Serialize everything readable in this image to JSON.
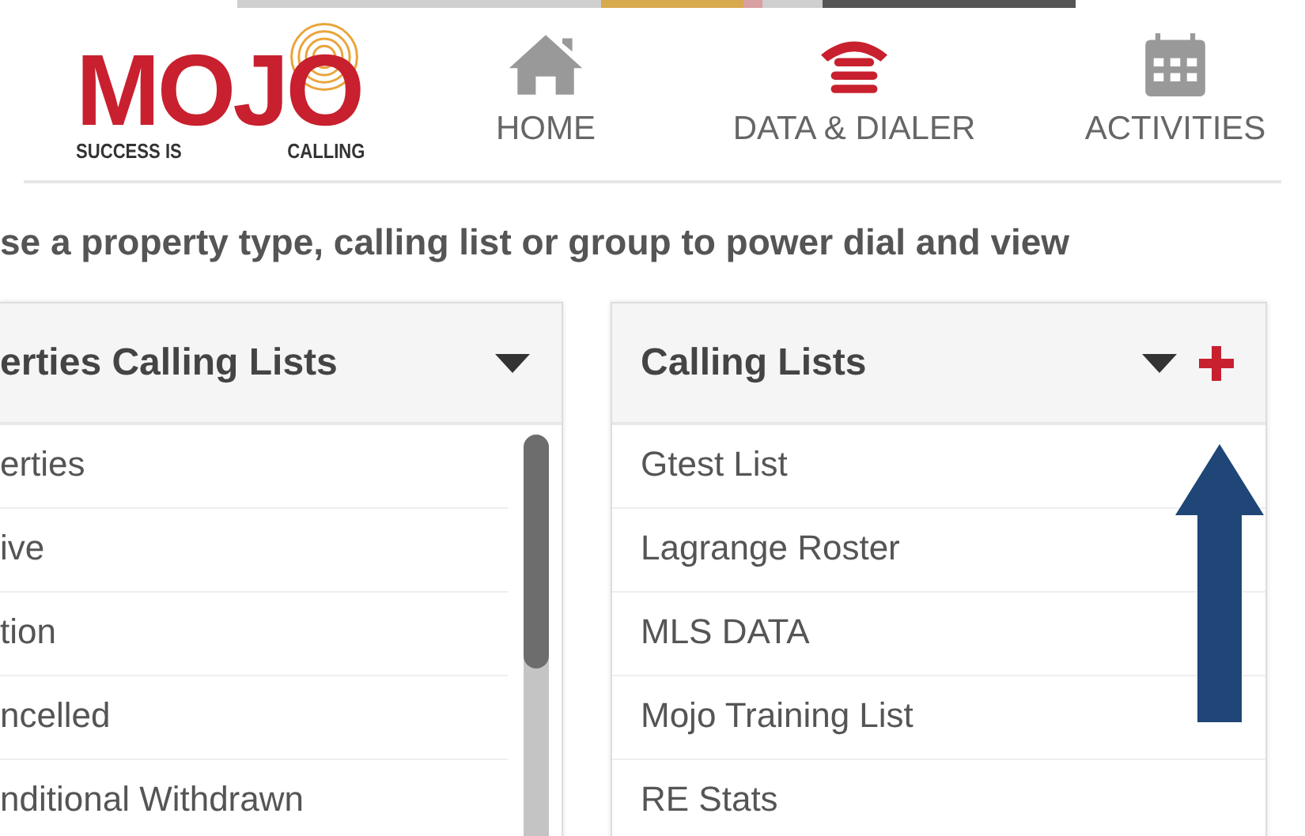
{
  "header": {
    "logo": {
      "word": "MOJO",
      "tagline_left": "SUCCESS IS",
      "tagline_right": "CALLING"
    },
    "nav": [
      {
        "label": "HOME",
        "selected": false
      },
      {
        "label": "DATA & DIALER",
        "selected": true
      },
      {
        "label": "ACTIVITIES",
        "selected": false
      }
    ]
  },
  "instruction": "se a property type, calling list or group to power dial and view",
  "panels": [
    {
      "title": "erties Calling Lists",
      "add_button": false,
      "items": [
        "erties",
        "ive",
        "tion",
        "ncelled",
        "nditional Withdrawn"
      ],
      "scrollbar": true
    },
    {
      "title": "Calling Lists",
      "add_button": true,
      "items": [
        "Gtest List",
        "Lagrange Roster",
        "MLS DATA",
        "Mojo Training List",
        "RE Stats"
      ],
      "scrollbar": false
    }
  ]
}
